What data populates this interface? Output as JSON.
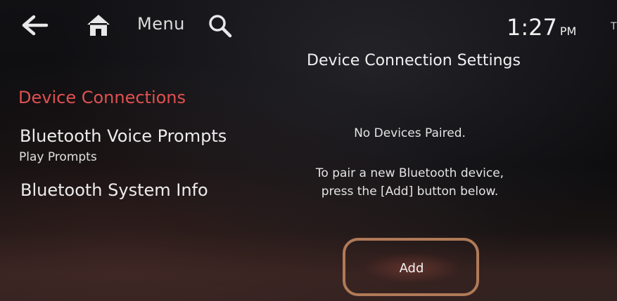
{
  "topbar": {
    "back_icon": "back-arrow-icon",
    "home_icon": "home-icon",
    "menu_label": "Menu",
    "search_icon": "search-icon",
    "time": "1:27",
    "ampm": "PM",
    "edge_letter": "T"
  },
  "left_menu": {
    "active_item": "Device Connections",
    "items": [
      {
        "label": "Bluetooth Voice Prompts",
        "sublabel": "Play Prompts"
      },
      {
        "label": "Bluetooth System Info"
      }
    ]
  },
  "panel": {
    "title": "Device Connection Settings",
    "status": "No Devices Paired.",
    "instruction_line1": "To pair a new Bluetooth device,",
    "instruction_line2": "press the [Add] button below.",
    "add_button": "Add"
  },
  "colors": {
    "active_item": "#e05050",
    "highlight_outline": "#b07a58",
    "background": "#0c0c0e"
  }
}
